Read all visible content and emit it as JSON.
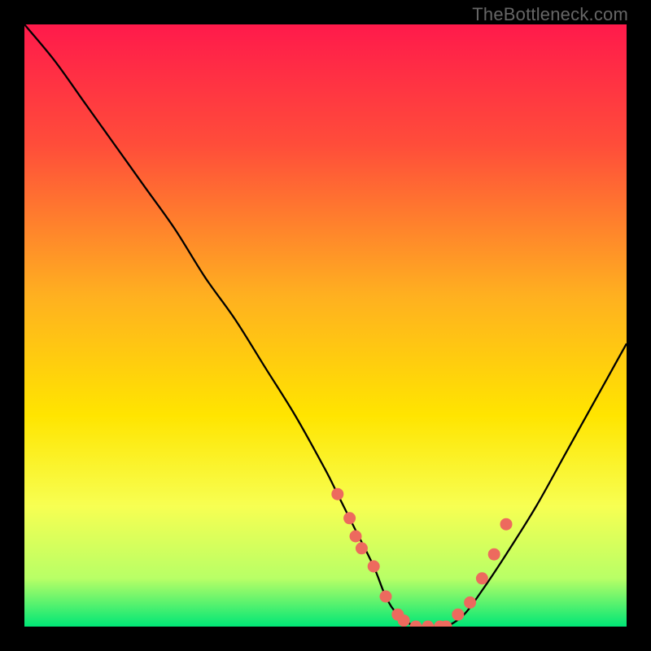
{
  "attribution": "TheBottleneck.com",
  "chart_data": {
    "type": "line",
    "title": "",
    "xlabel": "",
    "ylabel": "",
    "xlim": [
      0,
      100
    ],
    "ylim": [
      0,
      100
    ],
    "series": [
      {
        "name": "bottleneck-curve",
        "x": [
          0,
          5,
          10,
          15,
          20,
          25,
          30,
          35,
          40,
          45,
          50,
          52,
          55,
          58,
          60,
          62,
          65,
          68,
          70,
          73,
          76,
          80,
          85,
          90,
          95,
          100
        ],
        "y": [
          100,
          94,
          87,
          80,
          73,
          66,
          58,
          51,
          43,
          35,
          26,
          22,
          16,
          10,
          5,
          2,
          0,
          0,
          0,
          2,
          6,
          12,
          20,
          29,
          38,
          47
        ]
      }
    ],
    "markers": {
      "name": "sweet-spot-dots",
      "color": "#ed6a5e",
      "x": [
        52,
        54,
        55,
        56,
        58,
        60,
        62,
        63,
        65,
        67,
        69,
        70,
        72,
        74,
        76,
        78,
        80
      ],
      "y": [
        22,
        18,
        15,
        13,
        10,
        5,
        2,
        1,
        0,
        0,
        0,
        0,
        2,
        4,
        8,
        12,
        17
      ]
    },
    "gradient_stops": [
      {
        "offset": 0.0,
        "color": "#ff1a4b"
      },
      {
        "offset": 0.2,
        "color": "#ff4d3a"
      },
      {
        "offset": 0.45,
        "color": "#ffb020"
      },
      {
        "offset": 0.65,
        "color": "#ffe500"
      },
      {
        "offset": 0.8,
        "color": "#f7ff52"
      },
      {
        "offset": 0.92,
        "color": "#b8ff66"
      },
      {
        "offset": 1.0,
        "color": "#00e676"
      }
    ]
  }
}
